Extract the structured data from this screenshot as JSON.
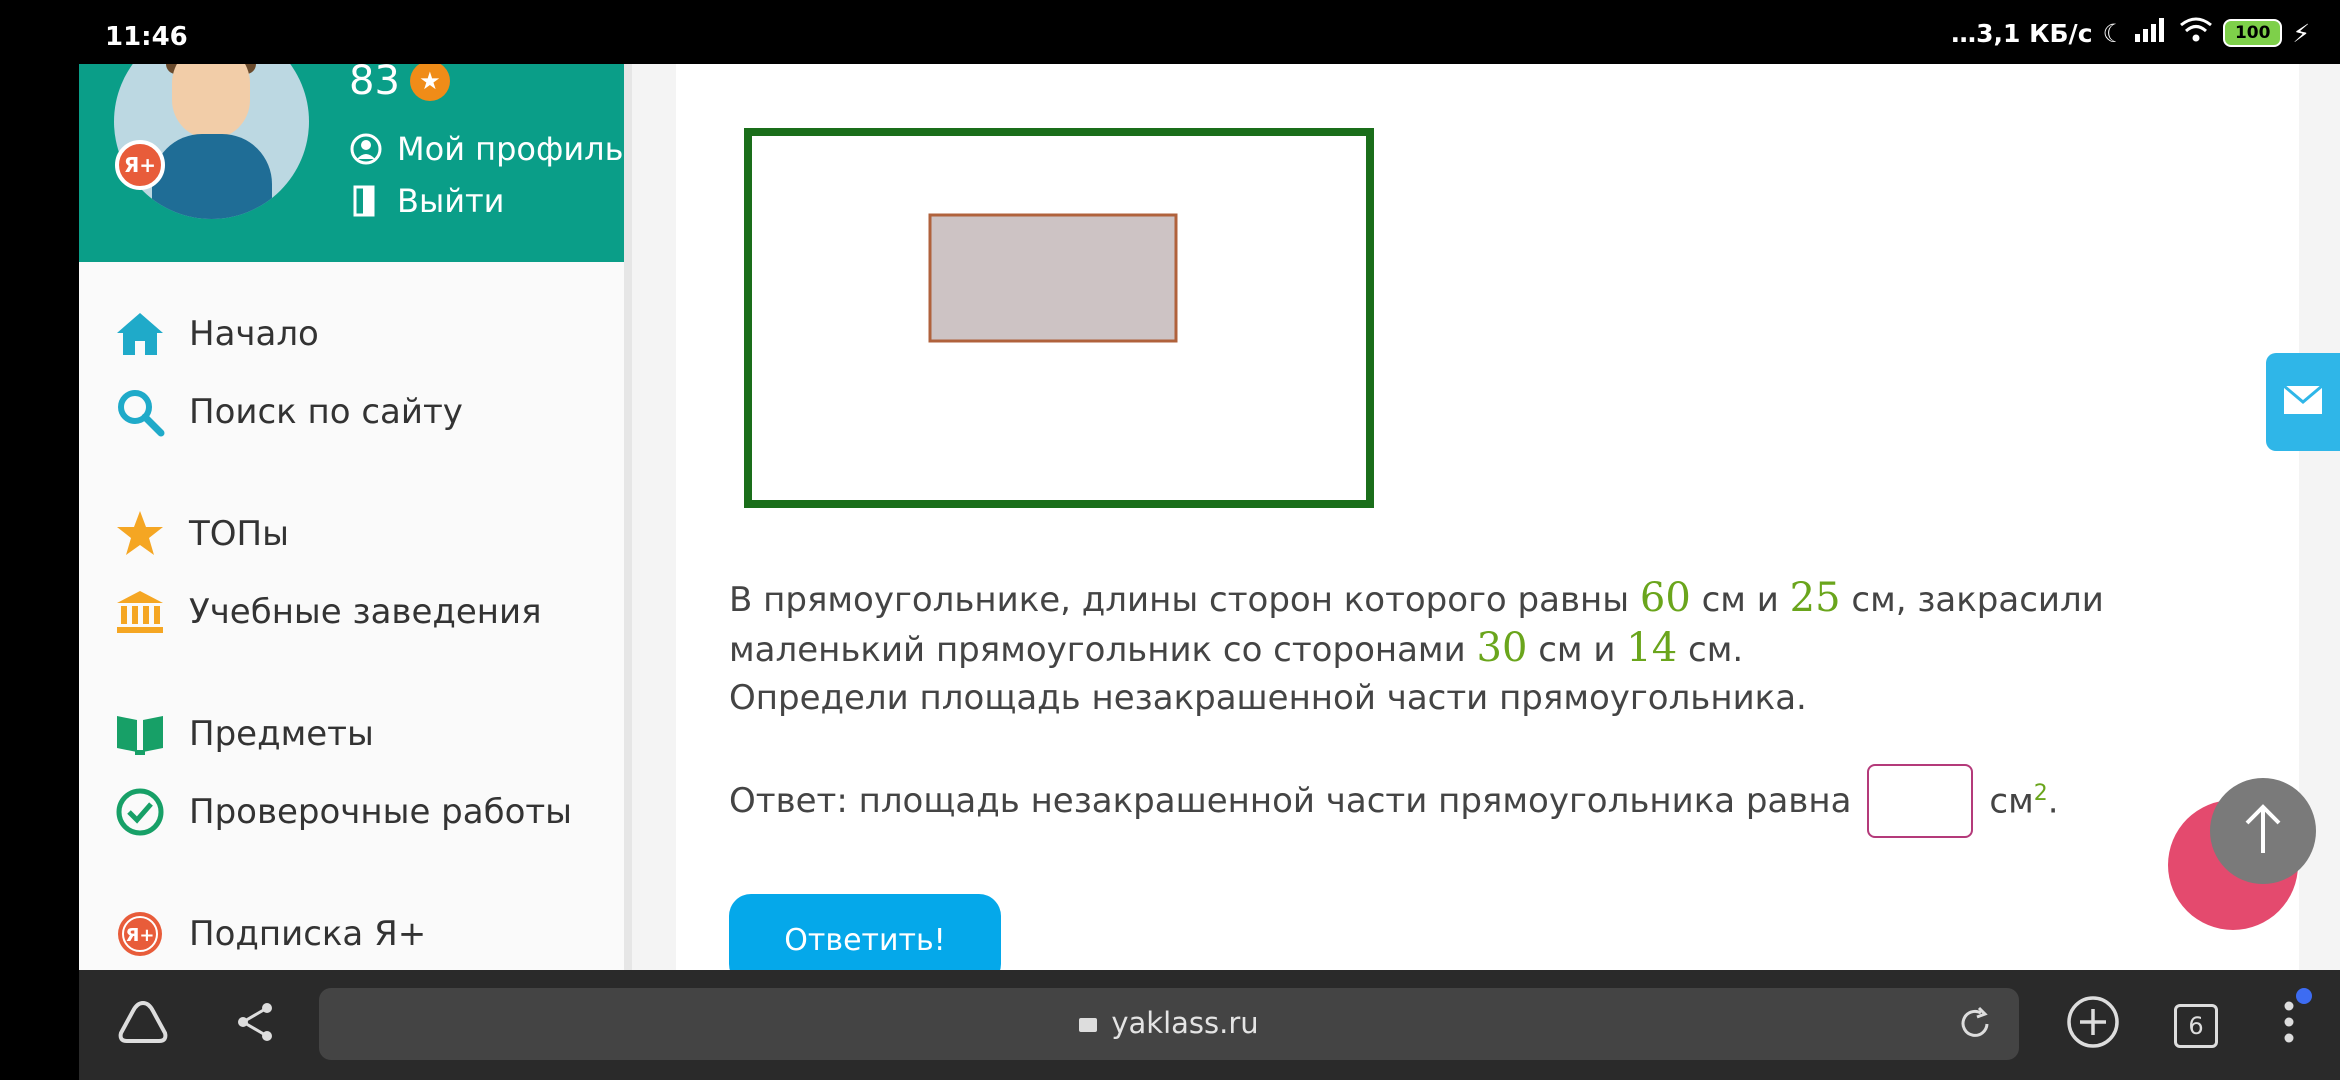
{
  "status": {
    "time": "11:46",
    "net_speed": "…3,1 КБ/с",
    "battery": "100"
  },
  "profile": {
    "points": "83",
    "badge": "Я+",
    "links": [
      "Мой профиль",
      "Выйти"
    ]
  },
  "menu": [
    {
      "label": "Начало",
      "icon": "home-icon"
    },
    {
      "label": "Поиск по сайту",
      "icon": "search-icon"
    },
    {
      "label": "ТОПы",
      "icon": "star-icon"
    },
    {
      "label": "Учебные заведения",
      "icon": "institution-icon"
    },
    {
      "label": "Предметы",
      "icon": "book-icon"
    },
    {
      "label": "Проверочные работы",
      "icon": "check-circle-icon"
    },
    {
      "label": "Подписка Я+",
      "icon": "ya-plus-icon"
    }
  ],
  "problem": {
    "t1": "В прямоугольнике, длины сторон которого равны",
    "n1": "60",
    "t2": "см и",
    "n2": "25",
    "t3": "см, закрасили маленький прямоугольник со сторонами",
    "n3": "30",
    "t4": "см и",
    "n4": "14",
    "t5": "см.",
    "question": "Определи площадь незакрашенной части прямоугольника."
  },
  "answer": {
    "label": "Ответ: площадь незакрашенной части прямоугольника равна",
    "value": "",
    "unit": "см",
    "exp": "2",
    "end": "."
  },
  "submit_label": "Ответить!",
  "browser": {
    "url": "yaklass.ru",
    "tabs": "6"
  },
  "colors": {
    "brand": "#0a9e88",
    "accent": "#05a8ea",
    "number": "#6aa51c"
  }
}
